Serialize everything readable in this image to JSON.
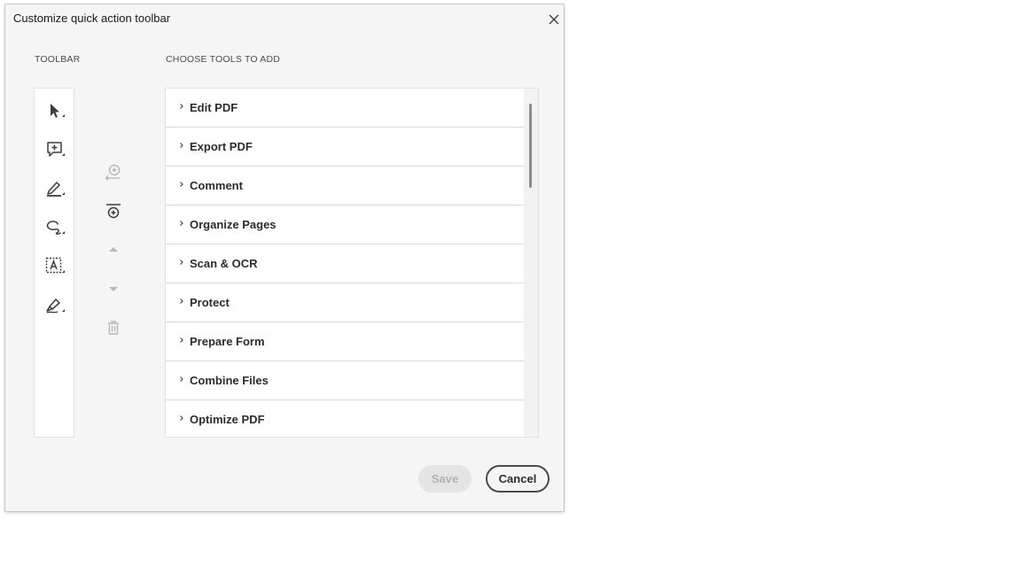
{
  "dialog": {
    "title": "Customize quick action toolbar",
    "toolbar_heading": "TOOLBAR",
    "tools_heading": "CHOOSE TOOLS TO ADD"
  },
  "toolbar_tools": [
    {
      "icon": "select-arrow-icon"
    },
    {
      "icon": "add-comment-icon"
    },
    {
      "icon": "highlight-pen-icon"
    },
    {
      "icon": "freehand-draw-icon"
    },
    {
      "icon": "text-box-icon"
    },
    {
      "icon": "sign-pen-icon"
    }
  ],
  "controls": [
    {
      "icon": "add-to-toolbar-icon",
      "enabled": false
    },
    {
      "icon": "add-divider-icon",
      "enabled": true
    },
    {
      "icon": "move-up-icon",
      "enabled": false
    },
    {
      "icon": "move-down-icon",
      "enabled": false
    },
    {
      "icon": "delete-icon",
      "enabled": false
    }
  ],
  "tool_groups": [
    {
      "label": "Edit PDF"
    },
    {
      "label": "Export PDF"
    },
    {
      "label": "Comment"
    },
    {
      "label": "Organize Pages"
    },
    {
      "label": "Scan & OCR"
    },
    {
      "label": "Protect"
    },
    {
      "label": "Prepare Form"
    },
    {
      "label": "Combine Files"
    },
    {
      "label": "Optimize PDF"
    }
  ],
  "buttons": {
    "save_label": "Save",
    "save_enabled": false,
    "cancel_label": "Cancel"
  },
  "colors": {
    "dialog_bg": "#f5f5f5",
    "disabled_icon": "#b8b8b8",
    "icon": "#3c3c3c"
  }
}
